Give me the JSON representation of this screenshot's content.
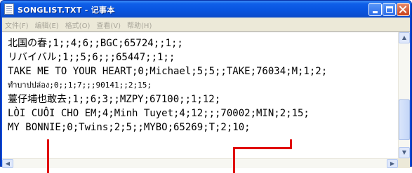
{
  "window": {
    "title": "SONGLIST.TXT - 记事本"
  },
  "menu": {
    "items": [
      {
        "label": "文件(F)"
      },
      {
        "label": "编辑(E)"
      },
      {
        "label": "格式(O)"
      },
      {
        "label": "查看(V)"
      },
      {
        "label": "帮助(H)"
      }
    ]
  },
  "document": {
    "lines": [
      "北国の春;1;;4;6;;BGC;65724;;1;;",
      "リバイバル;1;;5;6;;;65447;;1;;",
      "TAKE ME TO YOUR HEART;0;Michael;5;5;;TAKE;76034;M;1;2;",
      "ทำบาปปล่อง;0;;1;7;;;90141;;2;15;",
      "薹仔埔也敢去;1;;6;3;;MZPY;67100;;1;12;",
      "LÒI CUÔI CHO EM;4;Minh Tuyet;4;12;;;70002;MIN;2;15;",
      "MY BONNIE;0;Twins;2;5;;MYBO;65269;T;2;10;"
    ]
  },
  "icons": {
    "app": "notepad-icon",
    "minimize": "minimize-icon",
    "maximize": "maximize-icon",
    "close": "close-icon"
  },
  "colors": {
    "titlebar": "#0a4ed2",
    "annotation": "#e00000",
    "menubar": "#ece9d8"
  }
}
